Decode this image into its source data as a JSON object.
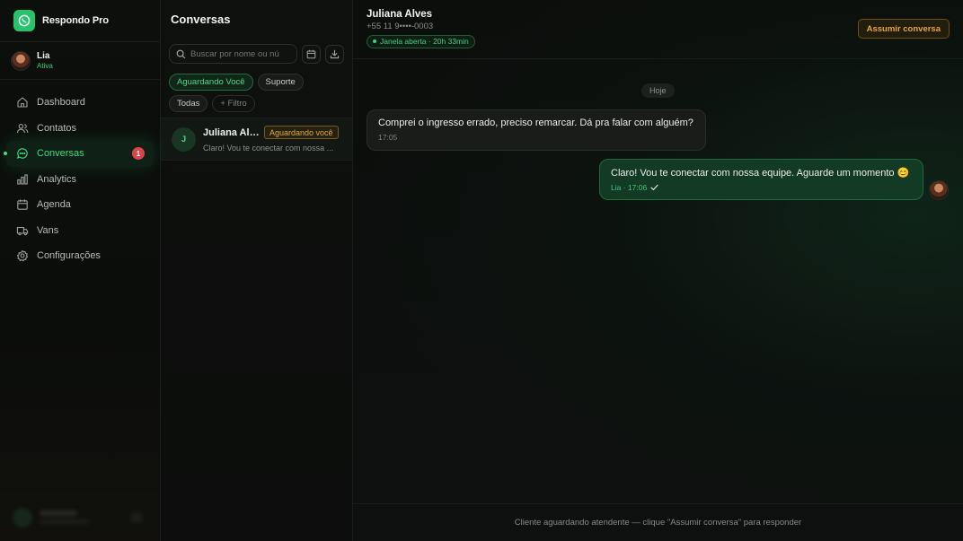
{
  "brand": {
    "name": "Respondo Pro",
    "logo_icon": "whatsapp-icon",
    "logo_color": "#25c46b"
  },
  "user": {
    "name": "Lia",
    "status": "Ativa"
  },
  "nav": {
    "items": [
      {
        "label": "Dashboard",
        "icon": "home-icon"
      },
      {
        "label": "Contatos",
        "icon": "users-icon"
      },
      {
        "label": "Conversas",
        "icon": "chat-icon",
        "active": true,
        "badge": "1"
      },
      {
        "label": "Analytics",
        "icon": "bar-chart-icon"
      },
      {
        "label": "Agenda",
        "icon": "calendar-icon"
      },
      {
        "label": "Vans",
        "icon": "truck-icon"
      },
      {
        "label": "Configurações",
        "icon": "gear-icon"
      }
    ]
  },
  "conversations": {
    "title": "Conversas",
    "search_placeholder": "Buscar por nome ou nú",
    "filters": [
      "Aguardando Você",
      "Suporte",
      "Todas"
    ],
    "add_filter": "+ Filtro",
    "items": [
      {
        "initial": "J",
        "name": "Juliana Alv...",
        "tag": "Aguardando você",
        "preview": "Claro! Vou te conectar com nossa ..."
      }
    ]
  },
  "chat": {
    "contact_name": "Juliana Alves",
    "contact_phone": "+55 11 9••••-0003",
    "window_status": "Janela aberta · 20h 33min",
    "assume_button": "Assumir conversa",
    "day_separator": "Hoje",
    "messages": [
      {
        "direction": "in",
        "text": "Comprei o ingresso errado, preciso remarcar. Dá pra falar com alguém?",
        "time": "17:05"
      },
      {
        "direction": "out",
        "text": "Claro! Vou te conectar com nossa equipe. Aguarde um momento 😊",
        "meta": "Lia · 17:06"
      }
    ],
    "footer_text": "Cliente aguardando atendente — clique \"Assumir conversa\" para responder"
  },
  "colors": {
    "accent": "#3fdc84",
    "warning": "#e9a43b",
    "badge": "#d8454b"
  }
}
